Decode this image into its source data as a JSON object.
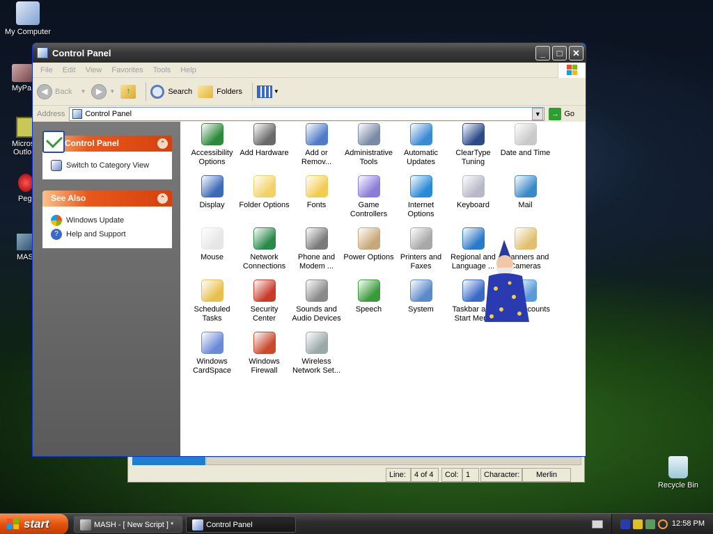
{
  "desktop": {
    "icons": [
      {
        "label": "My Computer",
        "icon": "my-computer-icon"
      },
      {
        "label": "MyPa",
        "icon": "mypa-icon"
      },
      {
        "label": "Micros",
        "label2": "Outlo",
        "icon": "outlook-icon"
      },
      {
        "label": "Peg",
        "icon": "peg-icon"
      },
      {
        "label": "MAS",
        "icon": "mash-icon"
      },
      {
        "label": "Recycle Bin",
        "icon": "recycle-bin-icon"
      }
    ]
  },
  "window": {
    "title": "Control Panel",
    "controls": {
      "minimize": "_",
      "maximize": "□",
      "close": "✕"
    },
    "menu": [
      "File",
      "Edit",
      "View",
      "Favorites",
      "Tools",
      "Help"
    ],
    "toolbar": {
      "back": "Back",
      "search": "Search",
      "folders": "Folders"
    },
    "address": {
      "label": "Address",
      "value": "Control Panel",
      "go": "Go"
    },
    "sidebar": {
      "control_panel": {
        "title": "Control Panel",
        "links": [
          "Switch to Category View"
        ]
      },
      "see_also": {
        "title": "See Also",
        "links": [
          "Windows Update",
          "Help and Support"
        ]
      }
    },
    "items": [
      {
        "line1": "Accessibility",
        "line2": "Options",
        "icon": "accessibility-icon",
        "color": "#2d8a3a"
      },
      {
        "line1": "Add Hardware",
        "line2": "",
        "icon": "add-hardware-icon",
        "color": "#6a6a6a"
      },
      {
        "line1": "Add or",
        "line2": "Remov...",
        "icon": "add-remove-programs-icon",
        "color": "#4e7cc8"
      },
      {
        "line1": "Administrative",
        "line2": "Tools",
        "icon": "administrative-tools-icon",
        "color": "#7a8aa8"
      },
      {
        "line1": "Automatic",
        "line2": "Updates",
        "icon": "automatic-updates-icon",
        "color": "#3b8bd4"
      },
      {
        "line1": "ClearType",
        "line2": "Tuning",
        "icon": "cleartype-icon",
        "color": "#2a4a8a"
      },
      {
        "line1": "Date and Time",
        "line2": "",
        "icon": "date-time-icon",
        "color": "#c9c9c9"
      },
      {
        "line1": "Display",
        "line2": "",
        "icon": "display-icon",
        "color": "#3a6ab8"
      },
      {
        "line1": "Folder Options",
        "line2": "",
        "icon": "folder-options-icon",
        "color": "#f2d267"
      },
      {
        "line1": "Fonts",
        "line2": "",
        "icon": "fonts-icon",
        "color": "#f2cc50"
      },
      {
        "line1": "Game",
        "line2": "Controllers",
        "icon": "game-controllers-icon",
        "color": "#8a7cd8"
      },
      {
        "line1": "Internet",
        "line2": "Options",
        "icon": "internet-options-icon",
        "color": "#2a8ad8"
      },
      {
        "line1": "Keyboard",
        "line2": "",
        "icon": "keyboard-icon",
        "color": "#b8b8c8"
      },
      {
        "line1": "Mail",
        "line2": "",
        "icon": "mail-icon",
        "color": "#3a8ac8"
      },
      {
        "line1": "Mouse",
        "line2": "",
        "icon": "mouse-icon",
        "color": "#e6e6e6"
      },
      {
        "line1": "Network",
        "line2": "Connections",
        "icon": "network-connections-icon",
        "color": "#2a8a4a"
      },
      {
        "line1": "Phone and",
        "line2": "Modem ...",
        "icon": "phone-modem-icon",
        "color": "#7a7a7a"
      },
      {
        "line1": "Power Options",
        "line2": "",
        "icon": "power-options-icon",
        "color": "#c8a878"
      },
      {
        "line1": "Printers and",
        "line2": "Faxes",
        "icon": "printers-faxes-icon",
        "color": "#a8a8a8"
      },
      {
        "line1": "Regional and",
        "line2": "Language ...",
        "icon": "regional-language-icon",
        "color": "#2a7ac8"
      },
      {
        "line1": "Scanners and",
        "line2": "Cameras",
        "icon": "scanners-cameras-icon",
        "color": "#e0c070"
      },
      {
        "line1": "Scheduled",
        "line2": "Tasks",
        "icon": "scheduled-tasks-icon",
        "color": "#e8c050"
      },
      {
        "line1": "Security",
        "line2": "Center",
        "icon": "security-center-icon",
        "color": "#c83a2a"
      },
      {
        "line1": "Sounds and",
        "line2": "Audio Devices",
        "icon": "sounds-audio-icon",
        "color": "#8a8a8a"
      },
      {
        "line1": "Speech",
        "line2": "",
        "icon": "speech-icon",
        "color": "#3a9a3a"
      },
      {
        "line1": "System",
        "line2": "",
        "icon": "system-icon",
        "color": "#5a8ac8"
      },
      {
        "line1": "Taskbar and",
        "line2": "Start Menu",
        "icon": "taskbar-start-menu-icon",
        "color": "#3a6ac8"
      },
      {
        "line1": "User Accounts",
        "line2": "",
        "icon": "user-accounts-icon",
        "color": "#5a9ad8"
      },
      {
        "line1": "Windows",
        "line2": "CardSpace",
        "icon": "windows-cardspace-icon",
        "color": "#6a8ad8"
      },
      {
        "line1": "Windows",
        "line2": "Firewall",
        "icon": "windows-firewall-icon",
        "color": "#c84a2a"
      },
      {
        "line1": "Wireless",
        "line2": "Network Set...",
        "icon": "wireless-network-icon",
        "color": "#9aa8a8"
      }
    ]
  },
  "bg_editor": {
    "status": {
      "line_label": "Line:",
      "line_value": "4 of 4",
      "col_label": "Col:",
      "col_value": "1",
      "char_label": "Character:",
      "char_value": "Merlin"
    }
  },
  "taskbar": {
    "start": "start",
    "tasks": [
      {
        "label": "MASH - [ New Script ] *",
        "icon": "mash-task-icon"
      },
      {
        "label": "Control Panel",
        "icon": "control-panel-task-icon"
      }
    ],
    "clock": "12:58 PM"
  }
}
